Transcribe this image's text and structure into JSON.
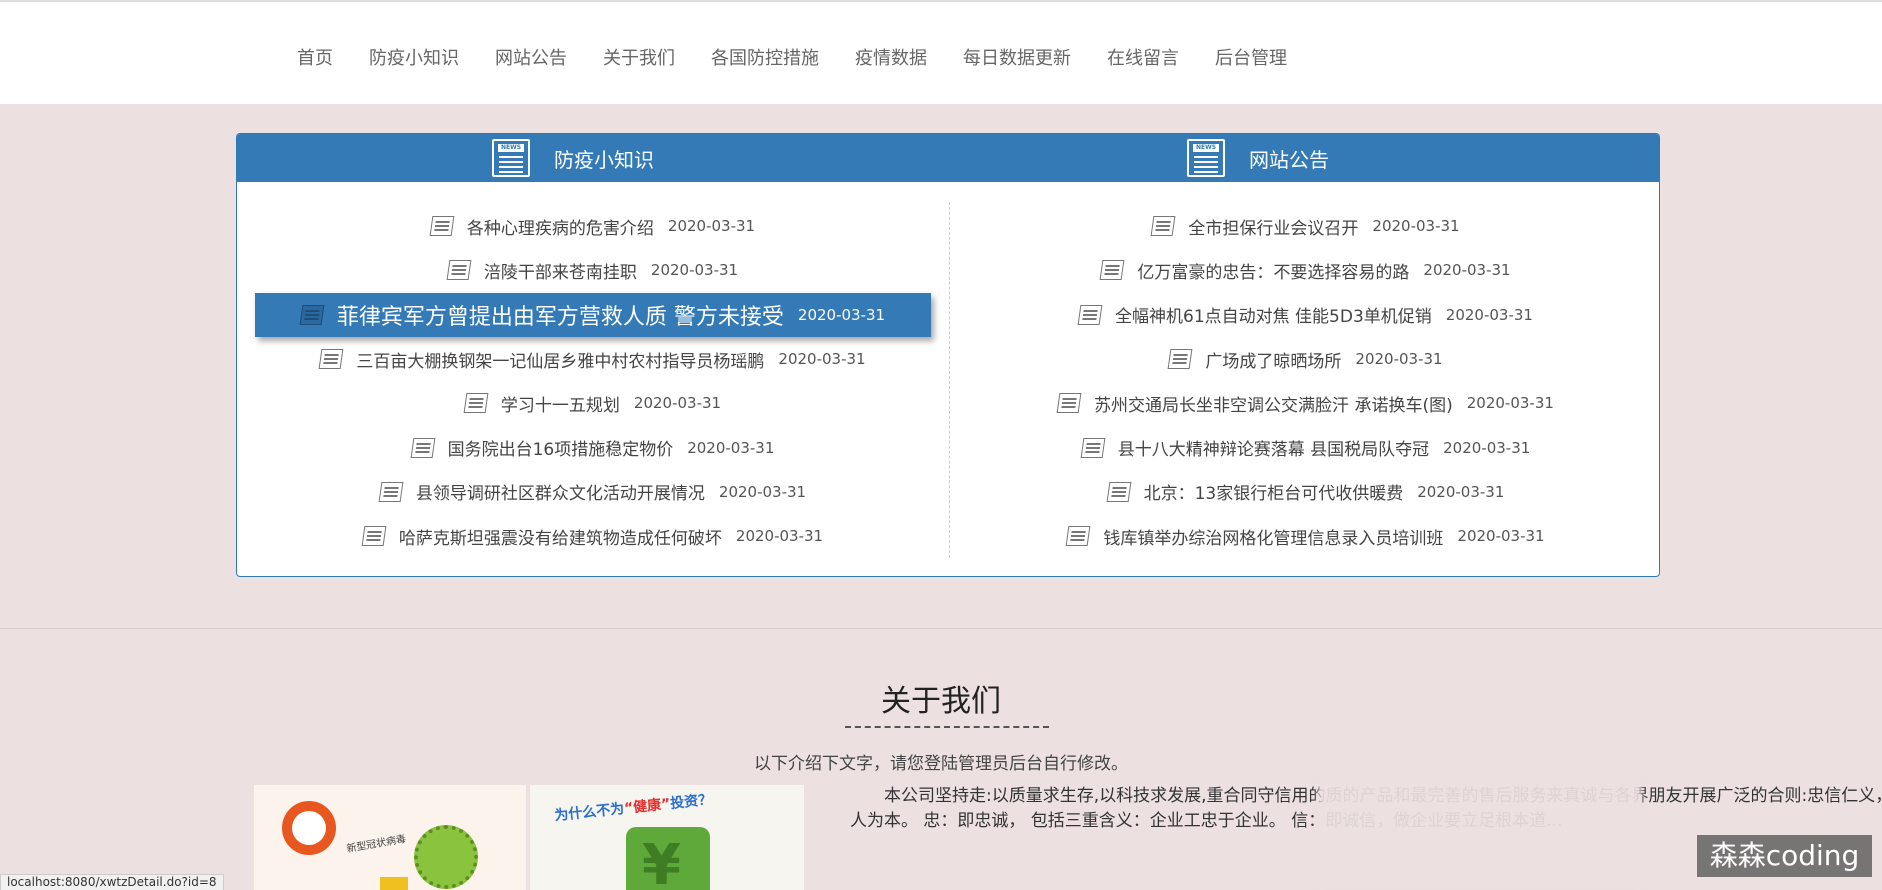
{
  "nav": {
    "items": [
      "首页",
      "防疫小知识",
      "网站公告",
      "关于我们",
      "各国防控措施",
      "疫情数据",
      "每日数据更新",
      "在线留言",
      "后台管理"
    ]
  },
  "panels": {
    "left_title": "防疫小知识",
    "right_title": "网站公告",
    "news_icon_tag": "NEWS"
  },
  "left_news": [
    {
      "title": "各种心理疾病的危害介绍",
      "date": "2020-03-31"
    },
    {
      "title": "涪陵干部来苍南挂职",
      "date": "2020-03-31"
    },
    {
      "title": "菲律宾军方曾提出由军方营救人质 警方未接受",
      "date": "2020-03-31"
    },
    {
      "title": "三百亩大棚换钢架一记仙居乡雅中村农村指导员杨瑶鹏",
      "date": "2020-03-31"
    },
    {
      "title": "学习十一五规划",
      "date": "2020-03-31"
    },
    {
      "title": "国务院出台16项措施稳定物价",
      "date": "2020-03-31"
    },
    {
      "title": "县领导调研社区群众文化活动开展情况",
      "date": "2020-03-31"
    },
    {
      "title": "哈萨克斯坦强震没有给建筑物造成任何破坏",
      "date": "2020-03-31"
    }
  ],
  "right_news": [
    {
      "title": "全市担保行业会议召开",
      "date": "2020-03-31"
    },
    {
      "title": "亿万富豪的忠告：不要选择容易的路",
      "date": "2020-03-31"
    },
    {
      "title": "全幅神机61点自动对焦 佳能5D3单机促销",
      "date": "2020-03-31"
    },
    {
      "title": "广场成了晾晒场所",
      "date": "2020-03-31"
    },
    {
      "title": "苏州交通局长坐非空调公交满脸汗 承诺换车(图)",
      "date": "2020-03-31"
    },
    {
      "title": "县十八大精神辩论赛落幕 县国税局队夺冠",
      "date": "2020-03-31"
    },
    {
      "title": "北京：13家银行柜台可代收供暖费",
      "date": "2020-03-31"
    },
    {
      "title": "钱库镇举办综治网格化管理信息录入员培训班",
      "date": "2020-03-31"
    }
  ],
  "about": {
    "title": "关于我们",
    "subtitle": "以下介绍下文字，请您登陆管理员后台自行修改。",
    "paragraph": "本公司坚持走:以质量求生存,以科技求发展,重合同守信用的质的产品和最完善的售后服务来真诚与各界朋友开展广泛的合则:忠信仁义，以人为本。 忠：即忠诚， 包括三重含义：企业工忠于企业。 信：即诚信，做企业要立足根本道...",
    "image1_caption": "新型冠状病毒",
    "image2_caption_a": "为什么不为",
    "image2_caption_b": "“健康”",
    "image2_caption_c": "投资？",
    "image2_symbol": "¥"
  },
  "status_url": "localhost:8080/xwtzDetail.do?id=8",
  "watermark": "森森coding",
  "colors": {
    "accent": "#337ab7",
    "page_bg": "#ece0e0"
  }
}
